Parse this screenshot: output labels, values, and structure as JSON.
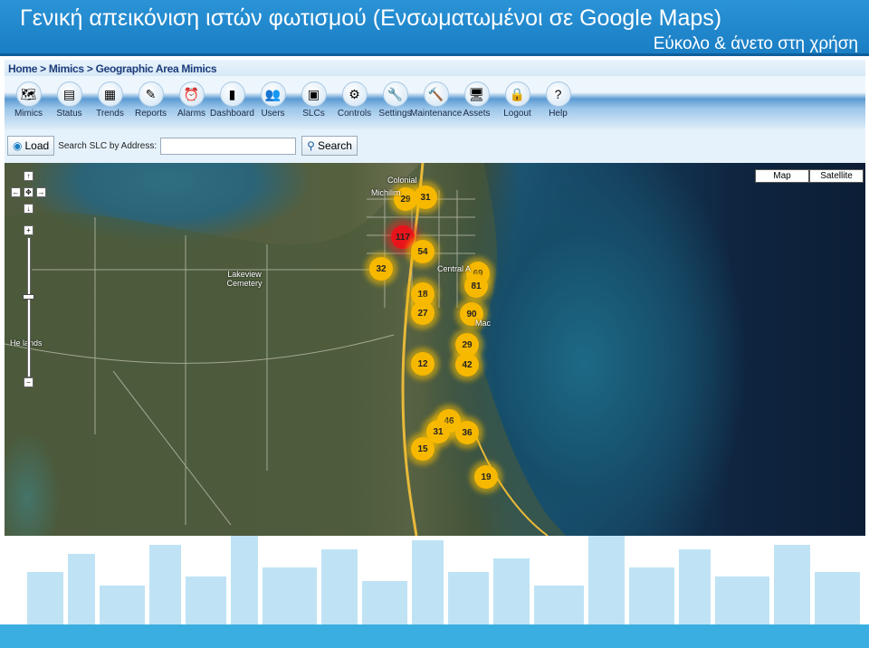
{
  "slide": {
    "title": "Γενική απεικόνιση ιστών φωτισμού (Ενσωματωμένοι σε  Google Maps)",
    "subtitle": "Εύκολο & άνετο στη χρήση"
  },
  "breadcrumb": "Home > Mimics > Geographic Area Mimics",
  "toolbar": [
    {
      "label": "Mimics",
      "icon": "mimics-icon",
      "glyph": "🗺"
    },
    {
      "label": "Status",
      "icon": "status-icon",
      "glyph": "▤"
    },
    {
      "label": "Trends",
      "icon": "trends-icon",
      "glyph": "▦"
    },
    {
      "label": "Reports",
      "icon": "reports-icon",
      "glyph": "✎"
    },
    {
      "label": "Alarms",
      "icon": "alarm-clock-icon",
      "glyph": "⏰"
    },
    {
      "label": "Dashboard",
      "icon": "dashboard-icon",
      "glyph": "▮"
    },
    {
      "label": "Users",
      "icon": "users-icon",
      "glyph": "👥"
    },
    {
      "label": "SLCs",
      "icon": "slcs-icon",
      "glyph": "▣"
    },
    {
      "label": "Controls",
      "icon": "controls-icon",
      "glyph": "⚙"
    },
    {
      "label": "Settings",
      "icon": "settings-icon",
      "glyph": "🔧"
    },
    {
      "label": "Maintenance",
      "icon": "maintenance-icon",
      "glyph": "🔨"
    },
    {
      "label": "Assets",
      "icon": "assets-icon",
      "glyph": "🖥"
    },
    {
      "label": "Logout",
      "icon": "lock-icon",
      "glyph": "🔒"
    },
    {
      "label": "Help",
      "icon": "help-icon",
      "glyph": "?"
    }
  ],
  "search": {
    "load_label": "Load",
    "label": "Search SLC by Address:",
    "value": "",
    "button_label": "Search"
  },
  "map": {
    "type_buttons": [
      "Map",
      "Satellite"
    ],
    "labels": [
      "Colonial",
      "Michilim",
      "Lakeview Cemetery",
      "Central A",
      "Mac",
      "He  lands"
    ],
    "clusters": [
      {
        "count": "29",
        "color": "#f7b800"
      },
      {
        "count": "31",
        "color": "#f7b800"
      },
      {
        "count": "117",
        "color": "#e8141b"
      },
      {
        "count": "54",
        "color": "#f7b800"
      },
      {
        "count": "32",
        "color": "#f7b800"
      },
      {
        "count": "69",
        "color": "#f7b800"
      },
      {
        "count": "81",
        "color": "#f7b800"
      },
      {
        "count": "18",
        "color": "#f7b800"
      },
      {
        "count": "27",
        "color": "#f7b800"
      },
      {
        "count": "90",
        "color": "#f7b800"
      },
      {
        "count": "29",
        "color": "#f7b800"
      },
      {
        "count": "42",
        "color": "#f7b800"
      },
      {
        "count": "12",
        "color": "#f7b800"
      },
      {
        "count": "46",
        "color": "#f7b800"
      },
      {
        "count": "31",
        "color": "#f7b800"
      },
      {
        "count": "36",
        "color": "#f7b800"
      },
      {
        "count": "15",
        "color": "#f7b800"
      },
      {
        "count": "19",
        "color": "#f7b800"
      }
    ]
  }
}
